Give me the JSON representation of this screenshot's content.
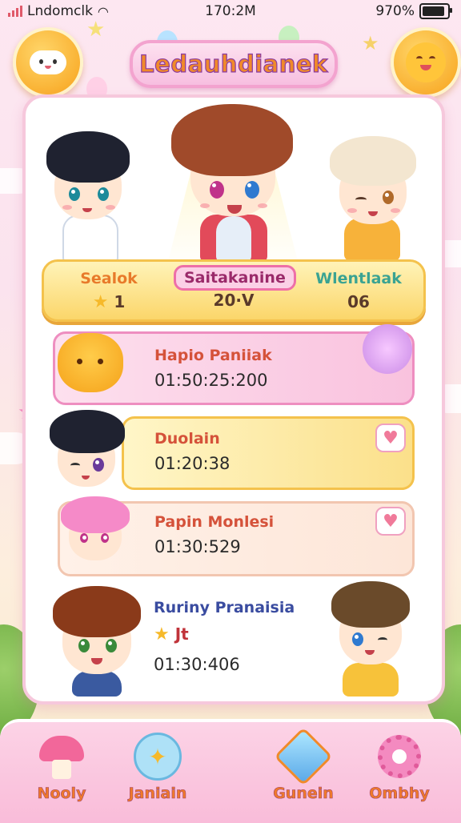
{
  "status_bar": {
    "carrier": "Lndomclk",
    "time": "170:2M",
    "battery": "970%",
    "battery_level": 0.9
  },
  "header": {
    "title": "Ledauhdianek"
  },
  "podium": {
    "left": {
      "name": "Sealok",
      "score": "1"
    },
    "center": {
      "name": "Saitakanine",
      "score": "20·V"
    },
    "right": {
      "name": "Wlentlaak",
      "score": "06"
    }
  },
  "entries": [
    {
      "name": "Hapio Paniiak",
      "time": "01:50:25:200"
    },
    {
      "name": "Duolain",
      "time": "01:20:38"
    },
    {
      "name": "Papin Monlesi",
      "time": "01:30:529"
    },
    {
      "name": "Ruriny Pranaisia",
      "badge": "Jt",
      "time": "01:30:406"
    }
  ],
  "nav": [
    {
      "label": "Nooly",
      "icon": "mushroom-house-icon"
    },
    {
      "label": "Janiain",
      "icon": "magic-wand-icon"
    },
    {
      "label": "Gunein",
      "icon": "gem-icon"
    },
    {
      "label": "Ombhy",
      "icon": "gear-icon"
    }
  ],
  "colors": {
    "accent_pink": "#f3a3cf",
    "accent_orange": "#f08a2a",
    "gold": "#fbd66a"
  }
}
